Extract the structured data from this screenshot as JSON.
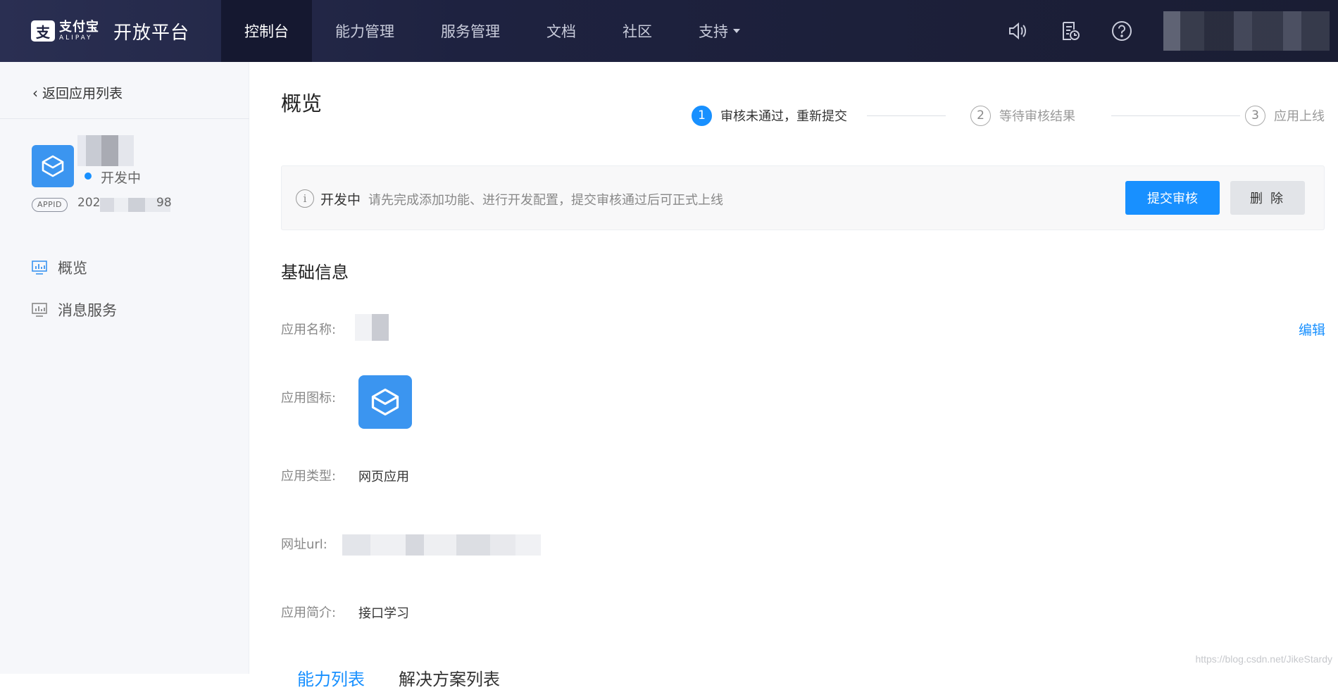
{
  "header": {
    "logo_cn": "支付宝",
    "logo_en": "ALIPAY",
    "platform_name": "开放平台",
    "nav": [
      {
        "label": "控制台",
        "active": true
      },
      {
        "label": "能力管理",
        "active": false
      },
      {
        "label": "服务管理",
        "active": false
      },
      {
        "label": "文档",
        "active": false
      },
      {
        "label": "社区",
        "active": false
      },
      {
        "label": "支持",
        "active": false,
        "dropdown": true
      }
    ],
    "icons": [
      "speaker-icon",
      "document-clock-icon",
      "help-icon"
    ]
  },
  "sidebar": {
    "back_label": "返回应用列表",
    "app_status": "开发中",
    "appid_badge": "APPID",
    "appid_prefix": "202",
    "appid_suffix": "98",
    "menu": [
      {
        "label": "概览",
        "icon": "monitor-chart-icon",
        "active": true
      },
      {
        "label": "消息服务",
        "icon": "monitor-chart-icon",
        "active": false
      }
    ]
  },
  "main": {
    "title": "概览",
    "steps": [
      {
        "num": "1",
        "label": "审核未通过，重新提交",
        "active": true
      },
      {
        "num": "2",
        "label": "等待审核结果",
        "active": false
      },
      {
        "num": "3",
        "label": "应用上线",
        "active": false
      }
    ],
    "notice": {
      "icon": "info-icon",
      "status": "开发中",
      "message": "请先完成添加功能、进行开发配置，提交审核通过后可正式上线",
      "submit_label": "提交审核",
      "delete_label": "删 除"
    },
    "basic_info": {
      "title": "基础信息",
      "edit_label": "编辑",
      "name_label": "应用名称:",
      "icon_label": "应用图标:",
      "type_label": "应用类型:",
      "type_value": "网页应用",
      "url_label": "网址url:",
      "desc_label": "应用简介:",
      "desc_value": "接口学习"
    },
    "bottom_tabs": [
      "能力列表",
      "解决方案列表"
    ]
  },
  "watermark": "https://blog.csdn.net/JikeStardy",
  "colors": {
    "accent": "#1890ff",
    "header_bg": "#1e2240",
    "sidebar_bg": "#f6f7fa",
    "app_icon": "#3b95f0"
  }
}
